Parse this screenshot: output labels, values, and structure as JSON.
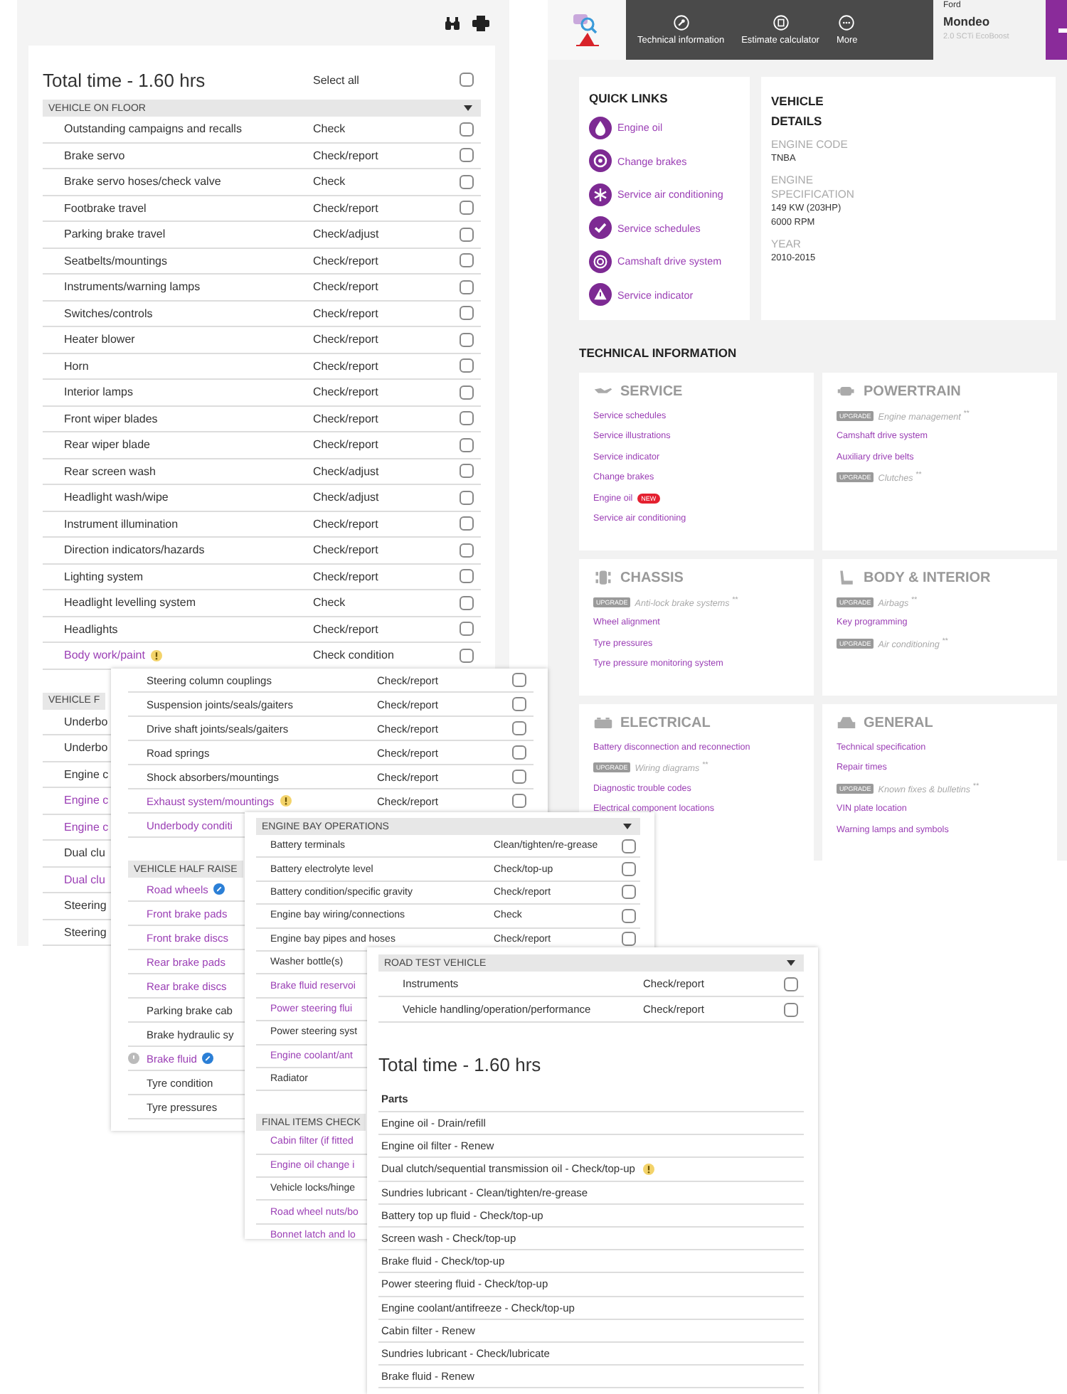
{
  "checklist": {
    "total_time": "Total time - 1.60 hrs",
    "select_all": "Select all",
    "select_all_checked": false,
    "sections": [
      {
        "title": "VEHICLE ON FLOOR",
        "expanded": true,
        "rows": [
          {
            "kind": "task",
            "task": "Outstanding campaigns and recalls",
            "action": "Check",
            "checked": false
          },
          {
            "kind": "task",
            "task": "Brake servo",
            "action": "Check/report",
            "checked": false
          },
          {
            "kind": "task",
            "task": "Brake servo hoses/check valve",
            "action": "Check",
            "checked": false
          },
          {
            "kind": "task",
            "task": "Footbrake travel",
            "action": "Check/report",
            "checked": false
          },
          {
            "kind": "task",
            "task": "Parking brake travel",
            "action": "Check/adjust",
            "checked": false
          },
          {
            "kind": "task",
            "task": "Seatbelts/mountings",
            "action": "Check/report",
            "checked": false
          },
          {
            "kind": "task",
            "task": "Instruments/warning lamps",
            "action": "Check/report",
            "checked": false
          },
          {
            "kind": "task",
            "task": "Switches/controls",
            "action": "Check/report",
            "checked": false
          },
          {
            "kind": "task",
            "task": "Heater blower",
            "action": "Check/report",
            "checked": false
          },
          {
            "kind": "task",
            "task": "Horn",
            "action": "Check/report",
            "checked": false
          },
          {
            "kind": "task",
            "task": "Interior lamps",
            "action": "Check/report",
            "checked": false
          },
          {
            "kind": "task",
            "task": "Front wiper blades",
            "action": "Check/report",
            "checked": false
          },
          {
            "kind": "task",
            "task": "Rear wiper blade",
            "action": "Check/report",
            "checked": false
          },
          {
            "kind": "task",
            "task": "Rear screen wash",
            "action": "Check/adjust",
            "checked": false
          },
          {
            "kind": "task",
            "task": "Headlight wash/wipe",
            "action": "Check/adjust",
            "checked": false
          },
          {
            "kind": "task",
            "task": "Instrument illumination",
            "action": "Check/report",
            "checked": false
          },
          {
            "kind": "task",
            "task": "Direction indicators/hazards",
            "action": "Check/report",
            "checked": false
          },
          {
            "kind": "task",
            "task": "Lighting system",
            "action": "Check/report",
            "checked": false
          },
          {
            "kind": "task",
            "task": "Headlight levelling system",
            "action": "Check",
            "checked": false
          },
          {
            "kind": "task",
            "task": "Headlights",
            "action": "Check/report",
            "checked": false
          },
          {
            "kind": "link",
            "task": "Body work/paint",
            "warning": true,
            "action": "Check condition",
            "checked": false
          }
        ]
      },
      {
        "title": "VEHICLE F",
        "rows": [
          {
            "kind": "task",
            "task": "Underbo"
          },
          {
            "kind": "task",
            "task": "Underbo"
          },
          {
            "kind": "task",
            "task": "Engine c"
          },
          {
            "kind": "link",
            "task": "Engine c"
          },
          {
            "kind": "link",
            "task": "Engine c"
          },
          {
            "kind": "task",
            "task": "Dual clu"
          },
          {
            "kind": "link",
            "task": "Dual clu"
          },
          {
            "kind": "task",
            "task": "Steering"
          },
          {
            "kind": "task",
            "task": "Steering"
          }
        ]
      }
    ]
  },
  "checklist_2": {
    "sections": [
      {
        "rows": [
          {
            "kind": "task",
            "task": "Steering column couplings",
            "action": "Check/report",
            "checked": false
          },
          {
            "kind": "task",
            "task": "Suspension joints/seals/gaiters",
            "action": "Check/report",
            "checked": false
          },
          {
            "kind": "task",
            "task": "Drive shaft joints/seals/gaiters",
            "action": "Check/report",
            "checked": false
          },
          {
            "kind": "task",
            "task": "Road springs",
            "action": "Check/report",
            "checked": false
          },
          {
            "kind": "task",
            "task": "Shock absorbers/mountings",
            "action": "Check/report",
            "checked": false
          },
          {
            "kind": "link",
            "task": "Exhaust system/mountings",
            "warning": true,
            "action": "Check/report",
            "checked": false
          },
          {
            "kind": "link",
            "task": "Underbody conditi"
          }
        ]
      },
      {
        "title": "VEHICLE HALF RAISE",
        "rows": [
          {
            "kind": "link",
            "task": "Road wheels",
            "info": true
          },
          {
            "kind": "link",
            "task": "Front brake pads"
          },
          {
            "kind": "link",
            "task": "Front brake discs"
          },
          {
            "kind": "link",
            "task": "Rear brake pads"
          },
          {
            "kind": "link",
            "task": "Rear brake discs"
          },
          {
            "kind": "task",
            "task": "Parking brake cab"
          },
          {
            "kind": "task",
            "task": "Brake hydraulic sy"
          },
          {
            "kind": "link",
            "task": "Brake fluid",
            "info": true,
            "pending": true
          },
          {
            "kind": "task",
            "task": "Tyre condition"
          },
          {
            "kind": "task",
            "task": "Tyre pressures"
          }
        ]
      }
    ]
  },
  "checklist_3": {
    "sections": [
      {
        "title": "ENGINE BAY OPERATIONS",
        "expanded": true,
        "rows": [
          {
            "kind": "task",
            "task": "Battery terminals",
            "action": "Clean/tighten/re-grease",
            "checked": false
          },
          {
            "kind": "task",
            "task": "Battery electrolyte level",
            "action": "Check/top-up",
            "checked": false
          },
          {
            "kind": "task",
            "task": "Battery condition/specific gravity",
            "action": "Check/report",
            "checked": false
          },
          {
            "kind": "task",
            "task": "Engine bay wiring/connections",
            "action": "Check",
            "checked": false
          },
          {
            "kind": "task",
            "task": "Engine bay pipes and hoses",
            "action": "Check/report",
            "checked": false
          },
          {
            "kind": "task",
            "task": "Washer bottle(s)"
          },
          {
            "kind": "link",
            "task": "Brake fluid reservoi"
          },
          {
            "kind": "link",
            "task": "Power steering flui"
          },
          {
            "kind": "task",
            "task": "Power steering syst"
          },
          {
            "kind": "link",
            "task": "Engine coolant/ant"
          },
          {
            "kind": "task",
            "task": "Radiator"
          }
        ]
      },
      {
        "title": "FINAL ITEMS CHECK",
        "rows": [
          {
            "kind": "link",
            "task": "Cabin filter (if fitted"
          },
          {
            "kind": "link",
            "task": "Engine oil change i"
          },
          {
            "kind": "task",
            "task": "Vehicle locks/hinge"
          },
          {
            "kind": "link",
            "task": "Road wheel nuts/bo"
          },
          {
            "kind": "link",
            "task": "Bonnet latch and lo"
          }
        ]
      }
    ]
  },
  "checklist_4": {
    "sections": [
      {
        "title": "ROAD TEST VEHICLE",
        "expanded": true,
        "rows": [
          {
            "kind": "task",
            "task": "Instruments",
            "action": "Check/report",
            "checked": false
          },
          {
            "kind": "task",
            "task": "Vehicle handling/operation/performance",
            "action": "Check/report",
            "checked": false
          }
        ]
      }
    ],
    "total_time": "Total time - 1.60 hrs",
    "parts_title": "Parts",
    "parts": [
      {
        "text": "Engine oil - Drain/refill"
      },
      {
        "text": "Engine oil filter - Renew"
      },
      {
        "text": "Dual clutch/sequential transmission oil - Check/top-up",
        "warning": true
      },
      {
        "text": "Sundries lubricant - Clean/tighten/re-grease"
      },
      {
        "text": "Battery top up fluid - Check/top-up"
      },
      {
        "text": "Screen wash - Check/top-up"
      },
      {
        "text": "Brake fluid - Check/top-up"
      },
      {
        "text": "Power steering fluid - Check/top-up"
      },
      {
        "text": "Engine coolant/antifreeze - Check/top-up"
      },
      {
        "text": "Cabin filter - Renew"
      },
      {
        "text": "Sundries lubricant - Check/lubricate"
      },
      {
        "text": "Brake fluid - Renew"
      }
    ]
  },
  "app": {
    "nav": [
      {
        "label": "Technical information"
      },
      {
        "label": "Estimate calculator"
      },
      {
        "label": "More"
      }
    ],
    "vehicle": {
      "make": "Ford",
      "model": "Mondeo",
      "engine": "2.0 SCTi EcoBoost"
    },
    "quick_links": {
      "title": "QUICK LINKS",
      "items": [
        "Engine oil",
        "Change brakes",
        "Service air conditioning",
        "Service schedules",
        "Camshaft drive system",
        "Service indicator"
      ]
    },
    "vehicle_details": {
      "title": "VEHICLE DETAILS",
      "fields": [
        {
          "label": "ENGINE CODE",
          "values": [
            "TNBA"
          ]
        },
        {
          "label": "ENGINE SPECIFICATION",
          "values": [
            "149 KW (203HP)",
            "6000 RPM"
          ]
        },
        {
          "label": "YEAR",
          "values": [
            "2010-2015"
          ]
        }
      ]
    },
    "technical_title": "TECHNICAL INFORMATION",
    "categories": [
      {
        "title": "SERVICE",
        "items": [
          {
            "kind": "link",
            "label": "Service schedules"
          },
          {
            "kind": "link",
            "label": "Service illustrations"
          },
          {
            "kind": "link",
            "label": "Service indicator"
          },
          {
            "kind": "link",
            "label": "Change brakes"
          },
          {
            "kind": "new",
            "label": "Engine oil",
            "badge": "NEW"
          },
          {
            "kind": "link",
            "label": "Service air conditioning"
          }
        ]
      },
      {
        "title": "POWERTRAIN",
        "items": [
          {
            "kind": "upgrade",
            "badge": "UPGRADE",
            "label": "Engine management",
            "note": "**"
          },
          {
            "kind": "link",
            "label": "Camshaft drive system"
          },
          {
            "kind": "link",
            "label": "Auxiliary drive belts"
          },
          {
            "kind": "upgrade",
            "badge": "UPGRADE",
            "label": "Clutches",
            "note": "**"
          }
        ]
      },
      {
        "title": "CHASSIS",
        "items": [
          {
            "kind": "upgrade",
            "badge": "UPGRADE",
            "label": "Anti-lock brake systems",
            "note": "**"
          },
          {
            "kind": "link",
            "label": "Wheel alignment"
          },
          {
            "kind": "link",
            "label": "Tyre pressures"
          },
          {
            "kind": "link",
            "label": "Tyre pressure monitoring system"
          }
        ]
      },
      {
        "title": "BODY & INTERIOR",
        "items": [
          {
            "kind": "upgrade",
            "badge": "UPGRADE",
            "label": "Airbags",
            "note": "**"
          },
          {
            "kind": "link",
            "label": "Key programming"
          },
          {
            "kind": "upgrade",
            "badge": "UPGRADE",
            "label": "Air conditioning",
            "note": "**"
          }
        ]
      },
      {
        "title": "ELECTRICAL",
        "items": [
          {
            "kind": "link",
            "label": "Battery disconnection and reconnection"
          },
          {
            "kind": "upgrade",
            "badge": "UPGRADE",
            "label": "Wiring diagrams",
            "note": "**"
          },
          {
            "kind": "link",
            "label": "Diagnostic trouble codes"
          },
          {
            "kind": "link",
            "label": "Electrical component locations"
          }
        ]
      },
      {
        "title": "GENERAL",
        "items": [
          {
            "kind": "link",
            "label": "Technical specification"
          },
          {
            "kind": "link",
            "label": "Repair times"
          },
          {
            "kind": "upgrade",
            "badge": "UPGRADE",
            "label": "Known fixes & bulletins",
            "note": "**"
          },
          {
            "kind": "link",
            "label": "VIN plate location"
          },
          {
            "kind": "link",
            "label": "Warning lamps and symbols"
          }
        ]
      }
    ]
  }
}
